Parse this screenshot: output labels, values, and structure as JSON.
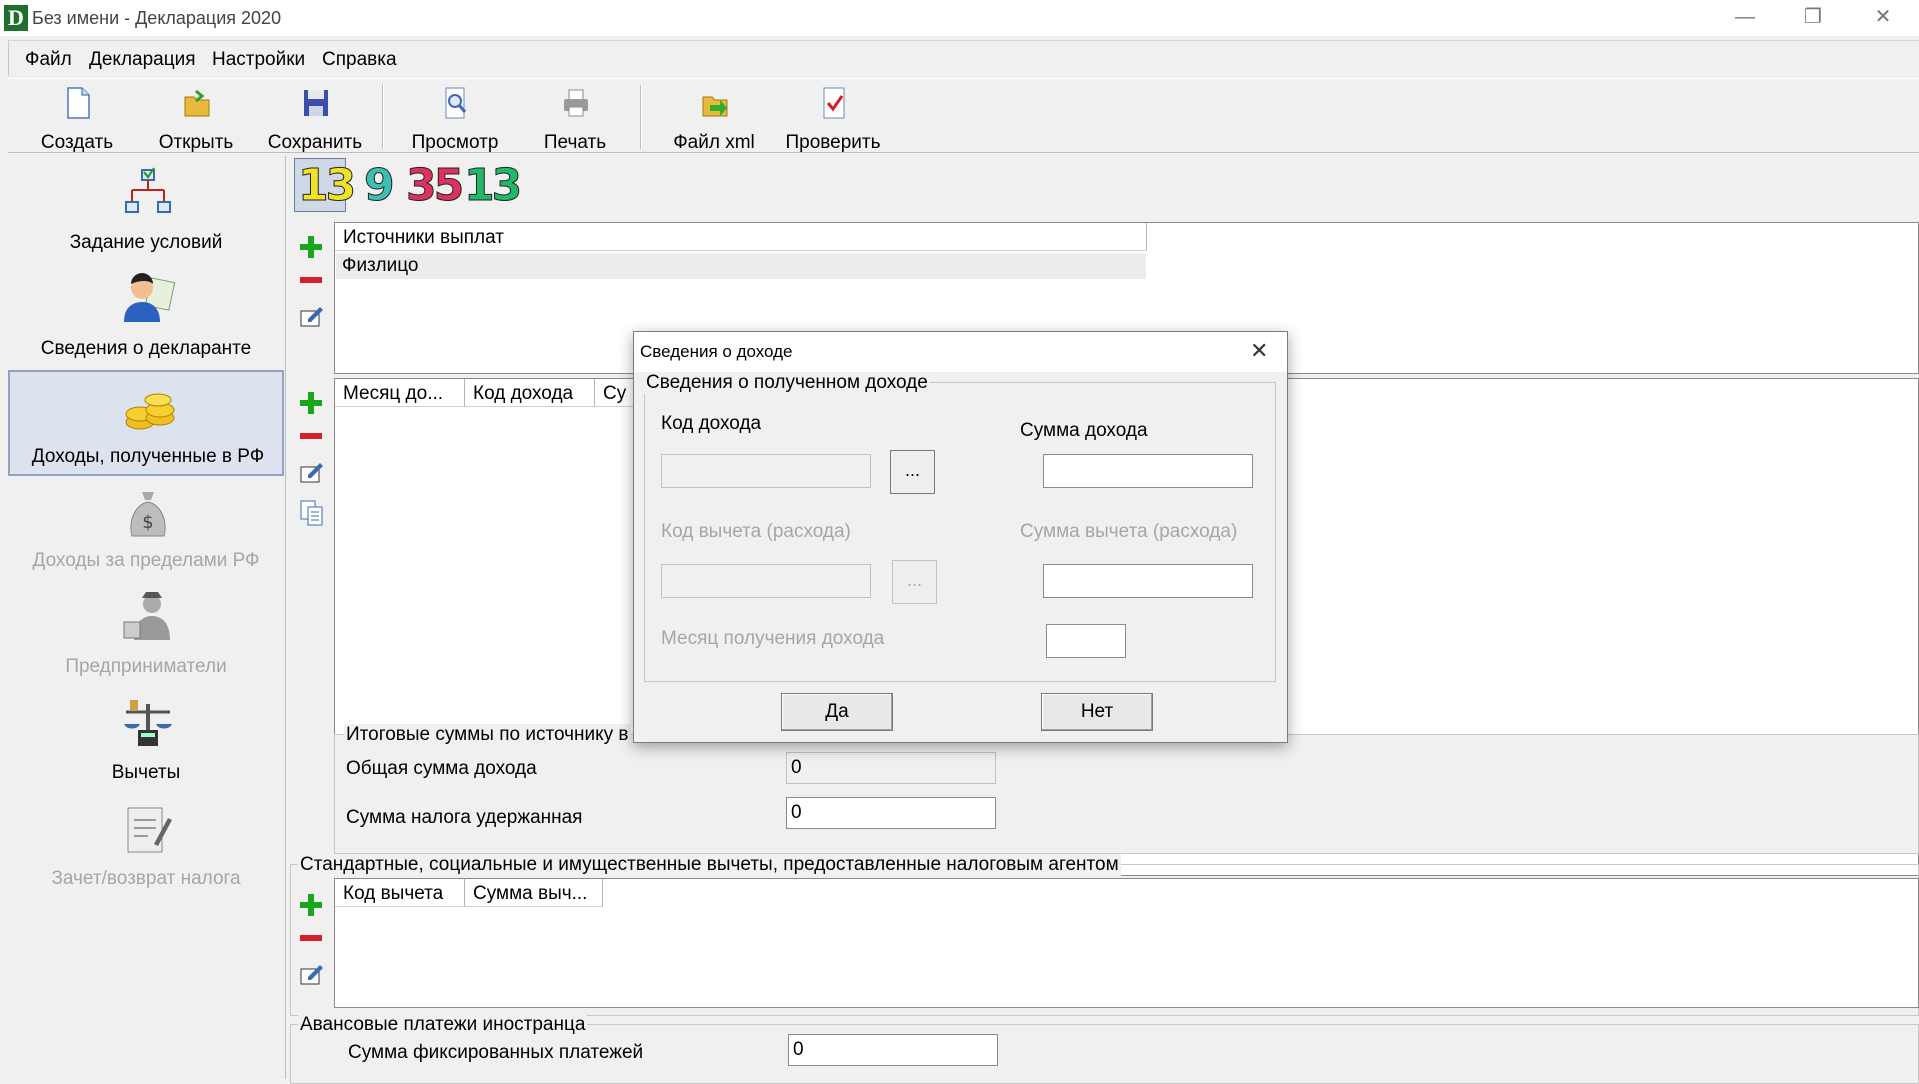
{
  "window": {
    "title": "Без имени - Декларация 2020",
    "logo_letter": "D"
  },
  "menu": [
    "Файл",
    "Декларация",
    "Настройки",
    "Справка"
  ],
  "toolbar": {
    "create": "Создать",
    "open": "Открыть",
    "save": "Сохранить",
    "preview": "Просмотр",
    "print": "Печать",
    "xml": "Файл xml",
    "check": "Проверить"
  },
  "sidebar": {
    "items": [
      {
        "label": "Задание условий",
        "icon": "conditions-tree-icon"
      },
      {
        "label": "Сведения о декларанте",
        "icon": "declarant-person-icon"
      },
      {
        "label": "Доходы, полученные в РФ",
        "icon": "coins-icon"
      },
      {
        "label": "Доходы за пределами РФ",
        "icon": "money-bag-icon"
      },
      {
        "label": "Предприниматели",
        "icon": "entrepreneur-icon"
      },
      {
        "label": "Вычеты",
        "icon": "scales-icon"
      },
      {
        "label": "Зачет/возврат налога",
        "icon": "document-pen-icon"
      }
    ]
  },
  "rates": [
    {
      "value": "13",
      "color": "#f2e227"
    },
    {
      "value": "9",
      "color": "#3cc0b0"
    },
    {
      "value": "35",
      "color": "#e03060"
    },
    {
      "value": "13",
      "color": "#21b86a"
    }
  ],
  "sources": {
    "header": "Источники выплат",
    "rows": [
      "Физлицо"
    ]
  },
  "income_table": {
    "columns": [
      "Месяц до...",
      "Код дохода",
      "Су"
    ]
  },
  "totals": {
    "group": "Итоговые суммы по источнику в",
    "income_label": "Общая сумма дохода",
    "income_value": "0",
    "tax_label": "Сумма налога удержанная",
    "tax_value": "0"
  },
  "deductions": {
    "group": "Стандартные, социальные и имущественные вычеты, предоставленные налоговым агентом",
    "columns": [
      "Код вычета",
      "Сумма выч..."
    ]
  },
  "advance": {
    "group": "Авансовые платежи иностранца",
    "label": "Сумма фиксированных платежей",
    "value": "0"
  },
  "dialog": {
    "title": "Сведения о доходе",
    "group": "Сведения о полученном доходе",
    "income_code": "Код дохода",
    "income_sum": "Сумма дохода",
    "deduction_code": "Код вычета (расхода)",
    "deduction_sum": "Сумма вычета (расхода)",
    "month": "Месяц получения дохода",
    "ellipsis": "...",
    "yes": "Да",
    "no": "Нет"
  }
}
